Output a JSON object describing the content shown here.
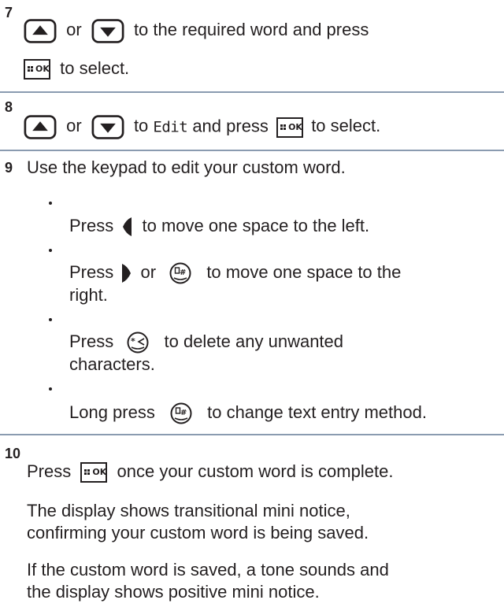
{
  "steps": [
    {
      "number": "7",
      "or": "or",
      "line1_suffix": "to the required word and press",
      "line2_suffix": "to select."
    },
    {
      "number": "8",
      "or": "or",
      "mid": "to",
      "target": "Edit",
      "mid2": "and press",
      "suffix": "to select."
    },
    {
      "number": "9",
      "text": "Use the keypad to edit your custom word.",
      "bullets": [
        {
          "prefix": "Press",
          "suffix": "to move one space to the left."
        },
        {
          "prefix": "Press",
          "or": "or",
          "suffix": "to move one space to the",
          "suffix2": "right."
        },
        {
          "prefix": "Press",
          "suffix": "to delete any unwanted",
          "suffix2": "characters."
        },
        {
          "prefix": "Long press",
          "suffix": "to change text entry method."
        }
      ]
    },
    {
      "number": "10",
      "prefix": "Press",
      "suffix": "once your custom word is complete.",
      "para1_line1": "The display shows transitional mini notice,",
      "para1_line2": "confirming your custom word is being saved.",
      "para2_line1": "If the custom word is saved, a tone sounds and",
      "para2_line2": "the display shows positive mini notice."
    }
  ],
  "icons": {
    "up": "up-arrow-key-icon",
    "down": "down-arrow-key-icon",
    "menu_ok": "menu-ok-key-icon",
    "ok_label": "OK",
    "left": "left-arrow-icon",
    "right": "right-arrow-icon",
    "pound": "pound-key-icon",
    "star": "star-key-icon"
  }
}
